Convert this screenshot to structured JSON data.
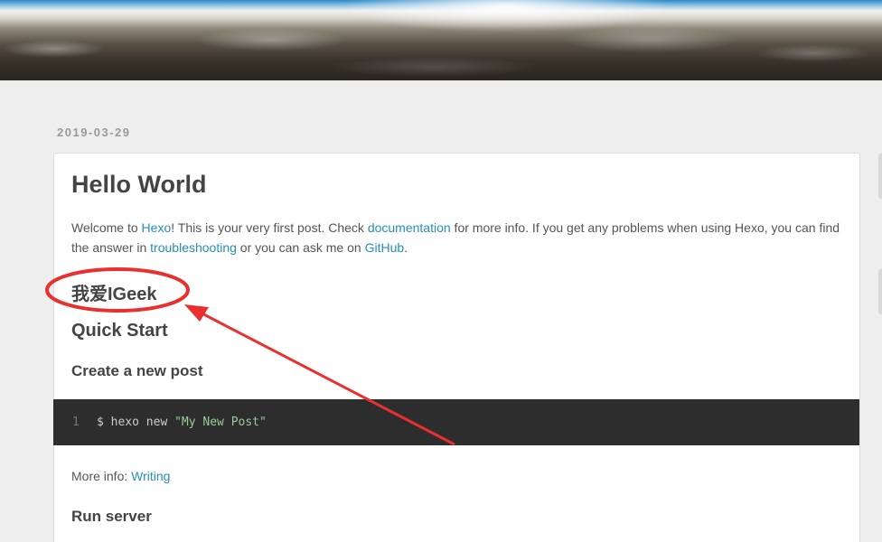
{
  "post": {
    "date": "2019-03-29",
    "title": "Hello World",
    "intro": {
      "welcome": "Welcome to ",
      "hexo_link": "Hexo",
      "after_hexo": "! This is your very first post. Check ",
      "documentation_link": "documentation",
      "after_docs": " for more info. If you get any problems when using Hexo, you can find the answer in ",
      "troubleshooting_link": "troubleshooting",
      "after_troubleshooting": " or you can ask me on ",
      "github_link": "GitHub",
      "end": "."
    },
    "heading_chinese": "我爱IGeek",
    "heading_quick_start": "Quick Start",
    "heading_create_post": "Create a new post",
    "code": {
      "line_number": "1",
      "command": "$ hexo new ",
      "argument": "\"My New Post\""
    },
    "more_info_label": "More info: ",
    "writing_link": "Writing",
    "heading_run_server": "Run server"
  },
  "annotation": {
    "color": "#e8302f"
  }
}
